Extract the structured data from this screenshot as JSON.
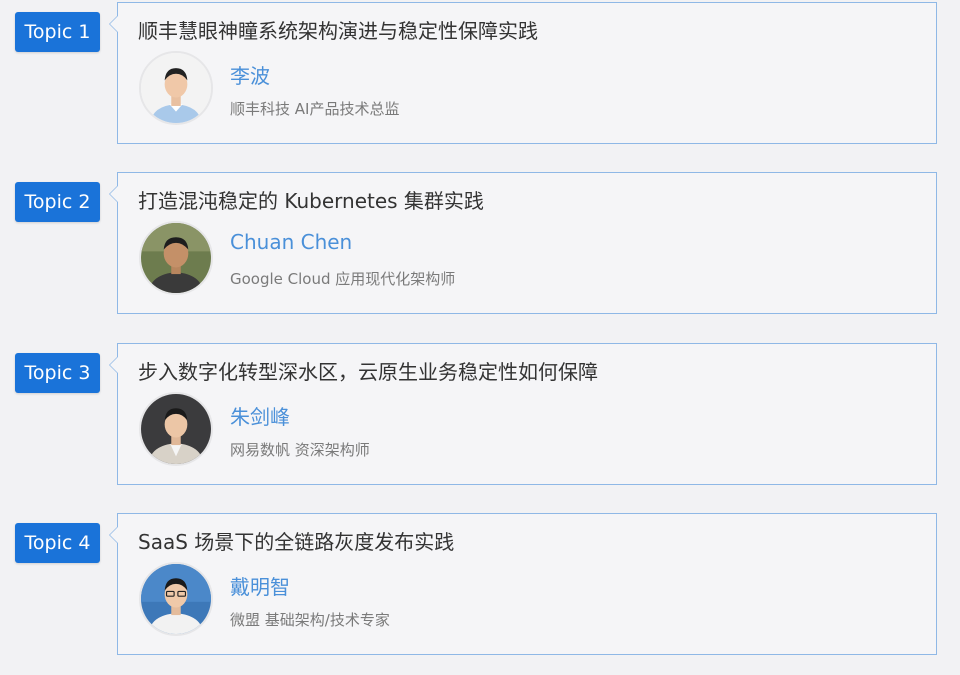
{
  "colors": {
    "badge_background": "#1a73d9",
    "badge_text": "#ffffff",
    "card_border": "#8fb8e6",
    "card_background": "#f5f5f7",
    "title_text": "#333333",
    "speaker_name": "#4a90d9",
    "speaker_title": "#7a7a7a",
    "page_background": "#f2f2f4"
  },
  "topics": [
    {
      "badge": "Topic 1",
      "title": "顺丰慧眼神瞳系统架构演进与稳定性保障实践",
      "speaker": {
        "name": "李波",
        "title": "顺丰科技 AI产品技术总监",
        "avatar_icon": "speaker-photo-icon"
      }
    },
    {
      "badge": "Topic 2",
      "title": "打造混沌稳定的 Kubernetes 集群实践",
      "speaker": {
        "name": "Chuan Chen",
        "title": "Google Cloud 应用现代化架构师",
        "avatar_icon": "speaker-photo-icon"
      }
    },
    {
      "badge": "Topic 3",
      "title": "步入数字化转型深水区，云原生业务稳定性如何保障",
      "speaker": {
        "name": "朱剑峰",
        "title": "网易数帆 资深架构师",
        "avatar_icon": "speaker-photo-icon"
      }
    },
    {
      "badge": "Topic 4",
      "title": "SaaS 场景下的全链路灰度发布实践",
      "speaker": {
        "name": "戴明智",
        "title": "微盟 基础架构/技术专家",
        "avatar_icon": "speaker-photo-icon"
      }
    }
  ]
}
